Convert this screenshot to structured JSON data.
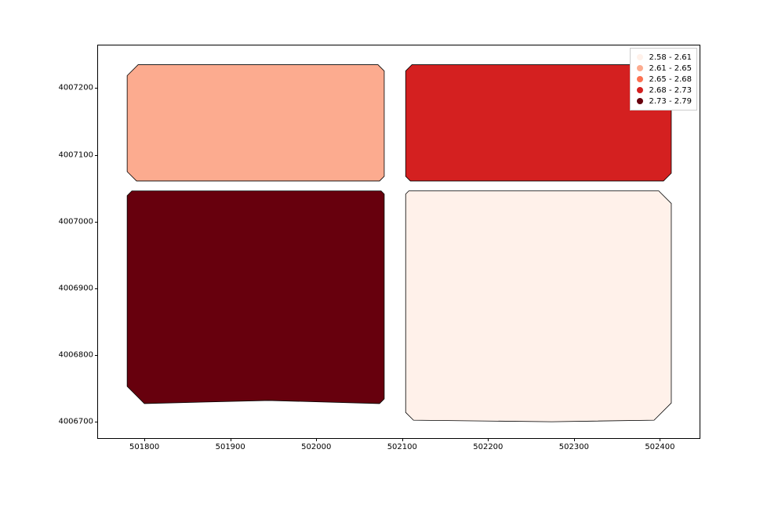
{
  "chart_data": {
    "type": "choropleth",
    "x_ticks": [
      501800,
      501900,
      502000,
      502100,
      502200,
      502300,
      502400
    ],
    "y_ticks": [
      4006700,
      4006800,
      4006900,
      4007000,
      4007100,
      4007200
    ],
    "xlim": [
      501746,
      502448
    ],
    "ylim": [
      4006673,
      4007264
    ],
    "legend": {
      "title": "",
      "position": "upper right",
      "entries": [
        {
          "label": "2.58 - 2.61",
          "color": "#fff1ea"
        },
        {
          "label": "2.61 - 2.65",
          "color": "#fcab8f"
        },
        {
          "label": "2.65 - 2.68",
          "color": "#fc7050"
        },
        {
          "label": "2.68 - 2.73",
          "color": "#d42020"
        },
        {
          "label": "2.73 - 2.79",
          "color": "#67000d"
        }
      ]
    },
    "polygons": [
      {
        "id": "top-left",
        "bin": "2.61 - 2.65",
        "color": "#fcab8f",
        "approx_bounds": {
          "xmin": 501780,
          "xmax": 502080,
          "ymin": 4007060,
          "ymax": 4007235
        }
      },
      {
        "id": "top-right",
        "bin": "2.68 - 2.73",
        "color": "#d42020",
        "approx_bounds": {
          "xmin": 502105,
          "xmax": 502415,
          "ymin": 4007060,
          "ymax": 4007235
        }
      },
      {
        "id": "bottom-left",
        "bin": "2.73 - 2.79",
        "color": "#67000d",
        "approx_bounds": {
          "xmin": 501780,
          "xmax": 502080,
          "ymin": 4006725,
          "ymax": 4007045
        }
      },
      {
        "id": "bottom-right",
        "bin": "2.58 - 2.61",
        "color": "#fff1ea",
        "approx_bounds": {
          "xmin": 502105,
          "xmax": 502415,
          "ymin": 4006700,
          "ymax": 4007045
        }
      }
    ]
  }
}
